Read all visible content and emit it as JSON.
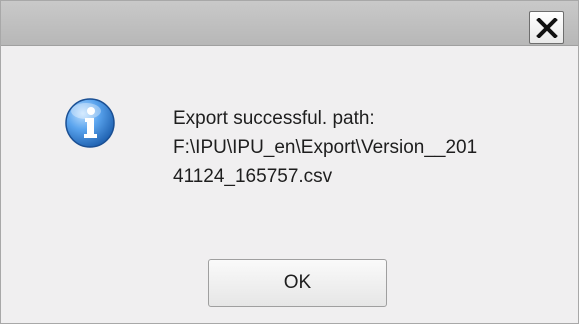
{
  "dialog": {
    "message_lines": [
      "Export successful. path:",
      "F:\\IPU\\IPU_en\\Export\\Version__201",
      "41124_165757.csv"
    ],
    "ok_label": "OK",
    "icon": "info-icon",
    "close_icon": "close-icon"
  },
  "colors": {
    "titlebar": "#c0c0c0",
    "background": "#f0eff0",
    "info_icon": "#2f7fd1"
  }
}
